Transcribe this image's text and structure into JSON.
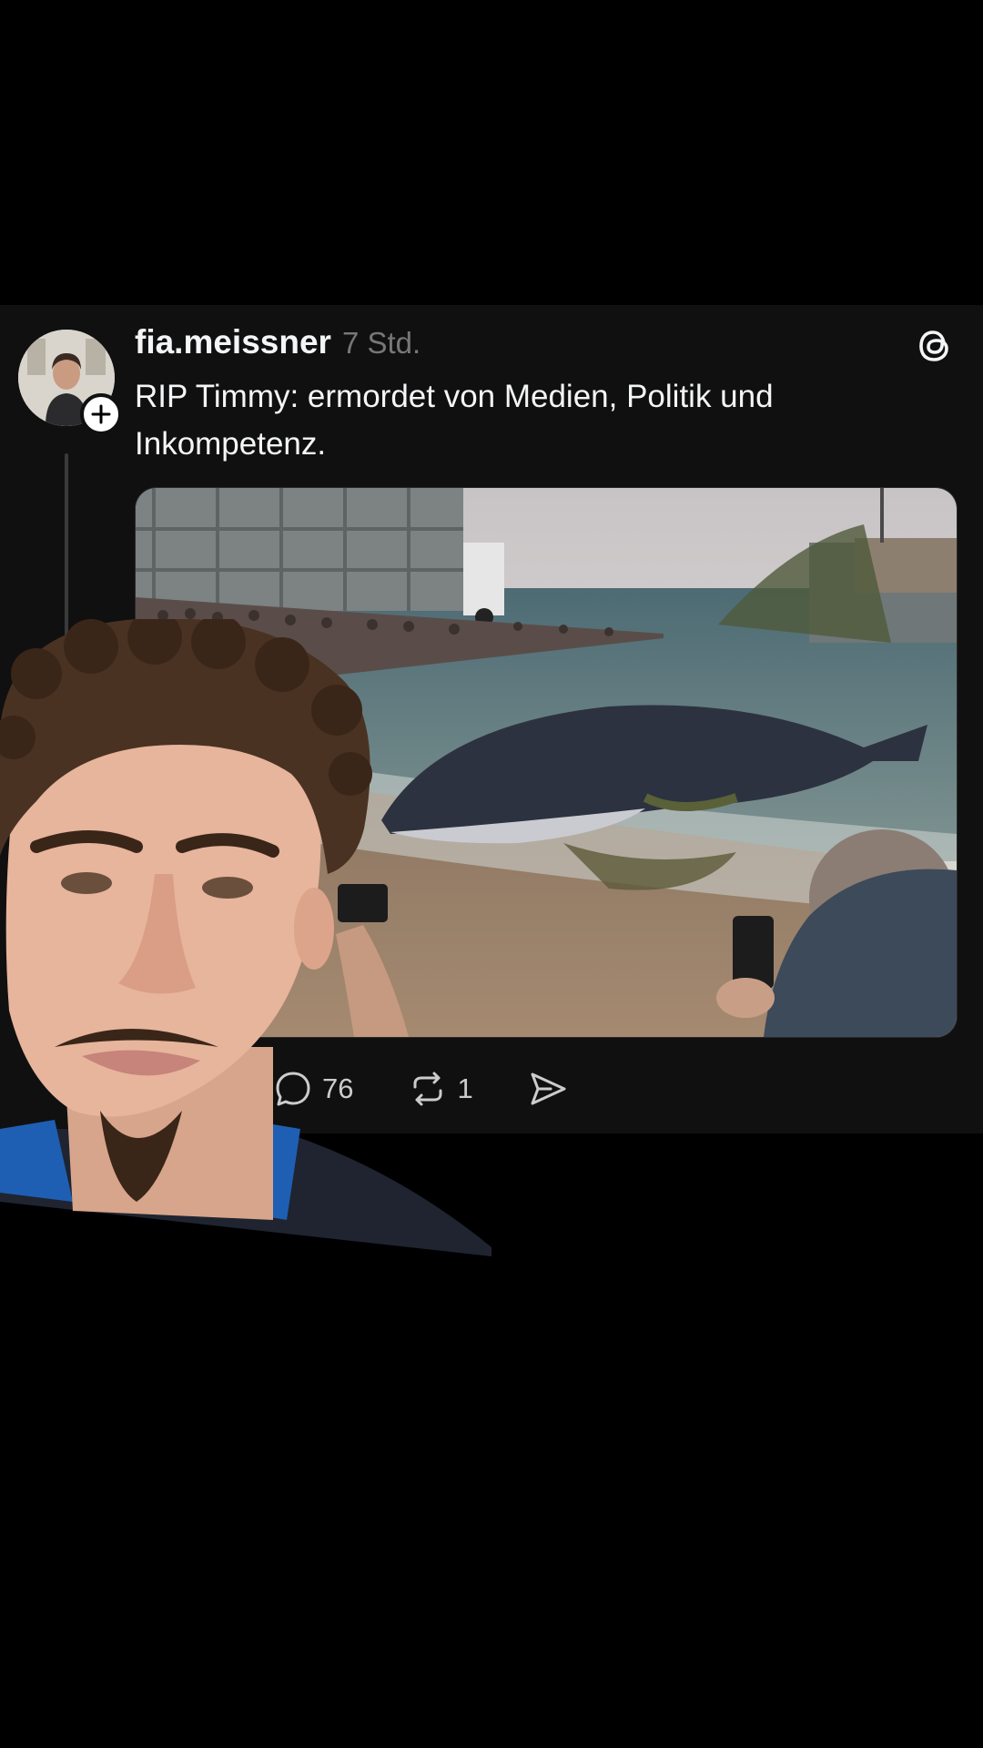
{
  "post": {
    "username": "fia.meissner",
    "timestamp": "7 Std.",
    "text": "RIP Timmy: ermordet von Medien, Politik und Inkompetenz.",
    "image_icon": "photo-whale-on-beach",
    "avatar_icon": "profile-photo",
    "follow_icon": "plus-icon",
    "app_icon": "threads-logo-icon"
  },
  "actions": {
    "reply_count": "76",
    "repost_count": "1",
    "reply_icon": "reply-bubble-icon",
    "repost_icon": "repost-icon",
    "share_icon": "share-send-icon"
  },
  "overlay": {
    "icon": "person-cutout-image"
  },
  "colors": {
    "background": "#000000",
    "card": "#101010",
    "text_primary": "#f3f5f7",
    "text_secondary": "#777777"
  }
}
